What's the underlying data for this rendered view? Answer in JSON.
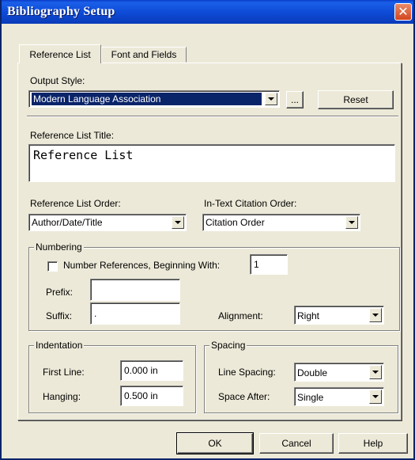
{
  "window": {
    "title": "Bibliography Setup",
    "close_label": "✕"
  },
  "tabs": [
    {
      "label": "Reference List"
    },
    {
      "label": "Font and Fields"
    }
  ],
  "output_style": {
    "label": "Output Style:",
    "value": "Modern Language Association",
    "browse_label": "...",
    "reset_label": "Reset"
  },
  "title_field": {
    "label": "Reference List Title:",
    "value": "Reference List"
  },
  "order": {
    "list_label": "Reference List Order:",
    "list_value": "Author/Date/Title",
    "citation_label": "In-Text Citation Order:",
    "citation_value": "Citation Order"
  },
  "numbering": {
    "group_label": "Numbering",
    "checkbox_label": "Number References, Beginning With:",
    "start_value": "1",
    "prefix_label": "Prefix:",
    "prefix_value": "",
    "suffix_label": "Suffix:",
    "suffix_value": ".",
    "alignment_label": "Alignment:",
    "alignment_value": "Right"
  },
  "indentation": {
    "group_label": "Indentation",
    "first_line_label": "First Line:",
    "first_line_value": "0.000 in",
    "hanging_label": "Hanging:",
    "hanging_value": "0.500 in"
  },
  "spacing": {
    "group_label": "Spacing",
    "line_spacing_label": "Line Spacing:",
    "line_spacing_value": "Double",
    "space_after_label": "Space After:",
    "space_after_value": "Single"
  },
  "buttons": {
    "ok": "OK",
    "cancel": "Cancel",
    "help": "Help"
  }
}
